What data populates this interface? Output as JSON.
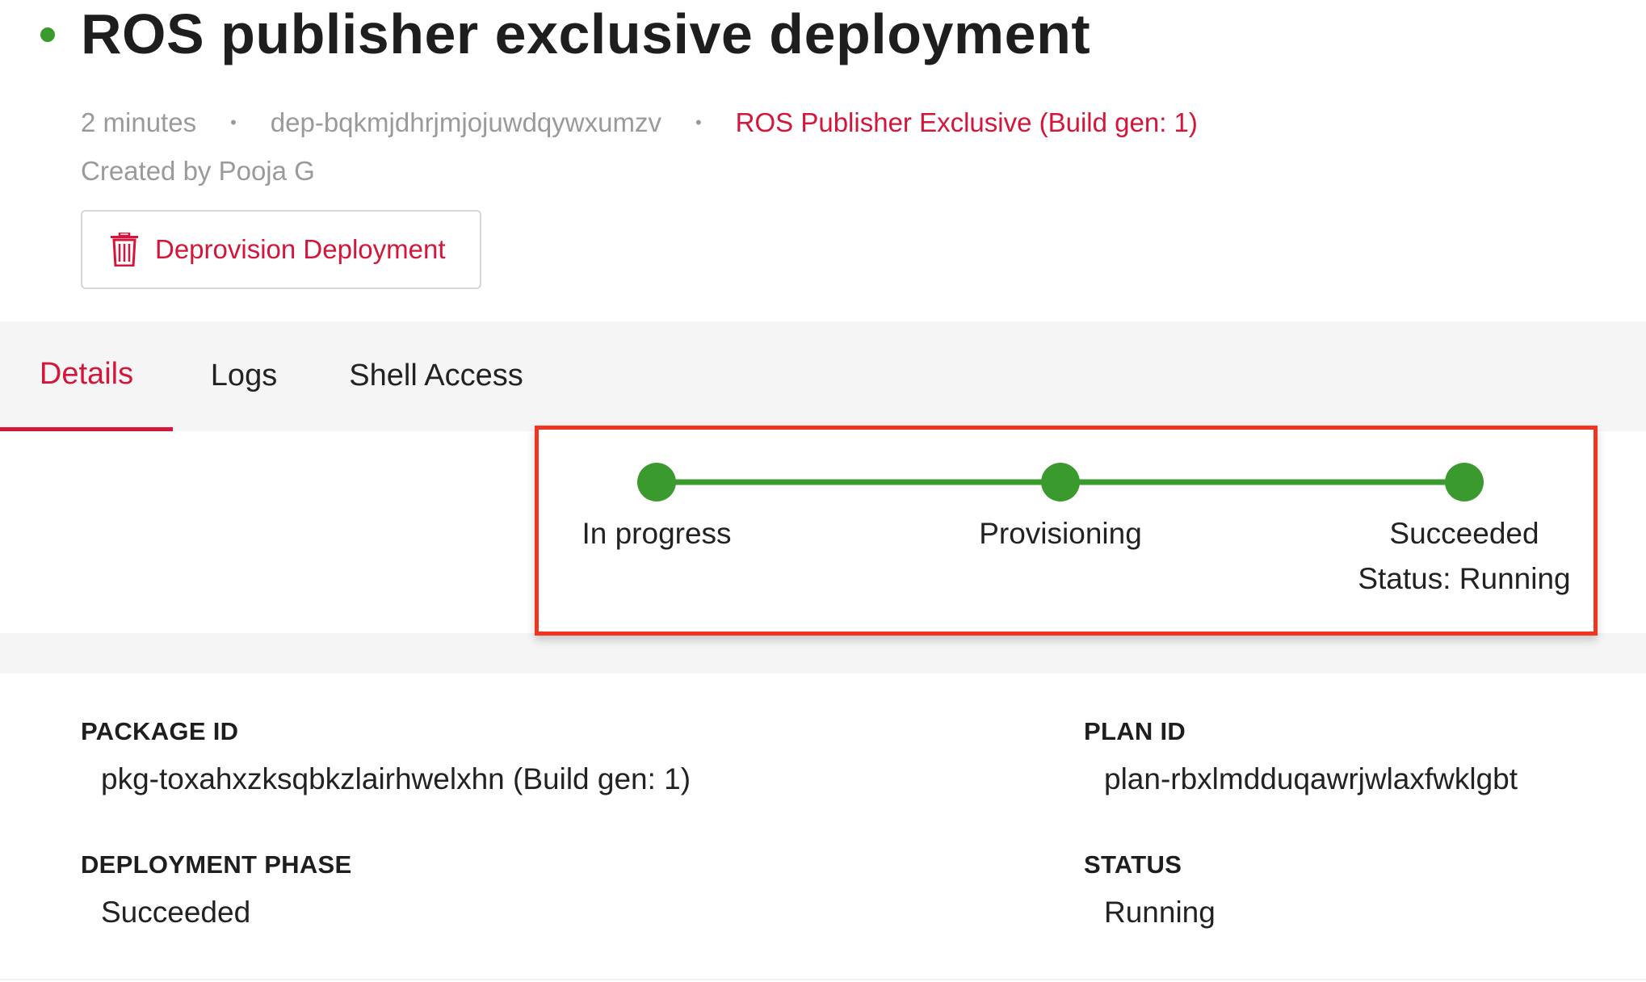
{
  "header": {
    "title": "ROS publisher exclusive deployment",
    "status_color": "#3a9a2e",
    "age": "2 minutes",
    "separator": "•",
    "deployment_id": "dep-bqkmjdhrjmjojuwdqywxumzv",
    "package_link": "ROS Publisher Exclusive (Build gen: 1)",
    "created_by": "Created by Pooja G"
  },
  "actions": {
    "deprovision_label": "Deprovision Deployment",
    "deprovision_icon": "trash-icon"
  },
  "tabs": [
    {
      "label": "Details",
      "active": true
    },
    {
      "label": "Logs",
      "active": false
    },
    {
      "label": "Shell Access",
      "active": false
    }
  ],
  "stepper": {
    "steps": [
      {
        "label": "In progress",
        "complete": true
      },
      {
        "label": "Provisioning",
        "complete": true
      },
      {
        "label": "Succeeded",
        "complete": true
      }
    ],
    "current_status": "Status: Running",
    "complete_color": "#3a9a2e",
    "highlight_color": "#f0351f"
  },
  "details": {
    "package_id": {
      "label": "PACKAGE ID",
      "value": "pkg-toxahxzksqbkzlairhwelxhn (Build gen: 1)"
    },
    "plan_id": {
      "label": "PLAN ID",
      "value": "plan-rbxlmdduqawrjwlaxfwklgbt"
    },
    "deployment_phase": {
      "label": "DEPLOYMENT PHASE",
      "value": "Succeeded"
    },
    "status": {
      "label": "STATUS",
      "value": "Running"
    }
  },
  "colors": {
    "accent": "#d3163a",
    "muted_text": "#9a9a9a",
    "band_background": "#f5f5f5"
  }
}
